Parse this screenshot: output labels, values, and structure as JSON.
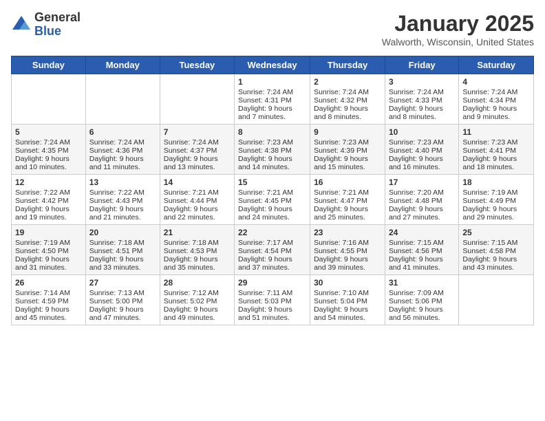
{
  "logo": {
    "general": "General",
    "blue": "Blue"
  },
  "title": "January 2025",
  "location": "Walworth, Wisconsin, United States",
  "days_of_week": [
    "Sunday",
    "Monday",
    "Tuesday",
    "Wednesday",
    "Thursday",
    "Friday",
    "Saturday"
  ],
  "weeks": [
    [
      {
        "day": "",
        "info": ""
      },
      {
        "day": "",
        "info": ""
      },
      {
        "day": "",
        "info": ""
      },
      {
        "day": "1",
        "info": "Sunrise: 7:24 AM\nSunset: 4:31 PM\nDaylight: 9 hours and 7 minutes."
      },
      {
        "day": "2",
        "info": "Sunrise: 7:24 AM\nSunset: 4:32 PM\nDaylight: 9 hours and 8 minutes."
      },
      {
        "day": "3",
        "info": "Sunrise: 7:24 AM\nSunset: 4:33 PM\nDaylight: 9 hours and 8 minutes."
      },
      {
        "day": "4",
        "info": "Sunrise: 7:24 AM\nSunset: 4:34 PM\nDaylight: 9 hours and 9 minutes."
      }
    ],
    [
      {
        "day": "5",
        "info": "Sunrise: 7:24 AM\nSunset: 4:35 PM\nDaylight: 9 hours and 10 minutes."
      },
      {
        "day": "6",
        "info": "Sunrise: 7:24 AM\nSunset: 4:36 PM\nDaylight: 9 hours and 11 minutes."
      },
      {
        "day": "7",
        "info": "Sunrise: 7:24 AM\nSunset: 4:37 PM\nDaylight: 9 hours and 13 minutes."
      },
      {
        "day": "8",
        "info": "Sunrise: 7:23 AM\nSunset: 4:38 PM\nDaylight: 9 hours and 14 minutes."
      },
      {
        "day": "9",
        "info": "Sunrise: 7:23 AM\nSunset: 4:39 PM\nDaylight: 9 hours and 15 minutes."
      },
      {
        "day": "10",
        "info": "Sunrise: 7:23 AM\nSunset: 4:40 PM\nDaylight: 9 hours and 16 minutes."
      },
      {
        "day": "11",
        "info": "Sunrise: 7:23 AM\nSunset: 4:41 PM\nDaylight: 9 hours and 18 minutes."
      }
    ],
    [
      {
        "day": "12",
        "info": "Sunrise: 7:22 AM\nSunset: 4:42 PM\nDaylight: 9 hours and 19 minutes."
      },
      {
        "day": "13",
        "info": "Sunrise: 7:22 AM\nSunset: 4:43 PM\nDaylight: 9 hours and 21 minutes."
      },
      {
        "day": "14",
        "info": "Sunrise: 7:21 AM\nSunset: 4:44 PM\nDaylight: 9 hours and 22 minutes."
      },
      {
        "day": "15",
        "info": "Sunrise: 7:21 AM\nSunset: 4:45 PM\nDaylight: 9 hours and 24 minutes."
      },
      {
        "day": "16",
        "info": "Sunrise: 7:21 AM\nSunset: 4:47 PM\nDaylight: 9 hours and 25 minutes."
      },
      {
        "day": "17",
        "info": "Sunrise: 7:20 AM\nSunset: 4:48 PM\nDaylight: 9 hours and 27 minutes."
      },
      {
        "day": "18",
        "info": "Sunrise: 7:19 AM\nSunset: 4:49 PM\nDaylight: 9 hours and 29 minutes."
      }
    ],
    [
      {
        "day": "19",
        "info": "Sunrise: 7:19 AM\nSunset: 4:50 PM\nDaylight: 9 hours and 31 minutes."
      },
      {
        "day": "20",
        "info": "Sunrise: 7:18 AM\nSunset: 4:51 PM\nDaylight: 9 hours and 33 minutes."
      },
      {
        "day": "21",
        "info": "Sunrise: 7:18 AM\nSunset: 4:53 PM\nDaylight: 9 hours and 35 minutes."
      },
      {
        "day": "22",
        "info": "Sunrise: 7:17 AM\nSunset: 4:54 PM\nDaylight: 9 hours and 37 minutes."
      },
      {
        "day": "23",
        "info": "Sunrise: 7:16 AM\nSunset: 4:55 PM\nDaylight: 9 hours and 39 minutes."
      },
      {
        "day": "24",
        "info": "Sunrise: 7:15 AM\nSunset: 4:56 PM\nDaylight: 9 hours and 41 minutes."
      },
      {
        "day": "25",
        "info": "Sunrise: 7:15 AM\nSunset: 4:58 PM\nDaylight: 9 hours and 43 minutes."
      }
    ],
    [
      {
        "day": "26",
        "info": "Sunrise: 7:14 AM\nSunset: 4:59 PM\nDaylight: 9 hours and 45 minutes."
      },
      {
        "day": "27",
        "info": "Sunrise: 7:13 AM\nSunset: 5:00 PM\nDaylight: 9 hours and 47 minutes."
      },
      {
        "day": "28",
        "info": "Sunrise: 7:12 AM\nSunset: 5:02 PM\nDaylight: 9 hours and 49 minutes."
      },
      {
        "day": "29",
        "info": "Sunrise: 7:11 AM\nSunset: 5:03 PM\nDaylight: 9 hours and 51 minutes."
      },
      {
        "day": "30",
        "info": "Sunrise: 7:10 AM\nSunset: 5:04 PM\nDaylight: 9 hours and 54 minutes."
      },
      {
        "day": "31",
        "info": "Sunrise: 7:09 AM\nSunset: 5:06 PM\nDaylight: 9 hours and 56 minutes."
      },
      {
        "day": "",
        "info": ""
      }
    ]
  ]
}
